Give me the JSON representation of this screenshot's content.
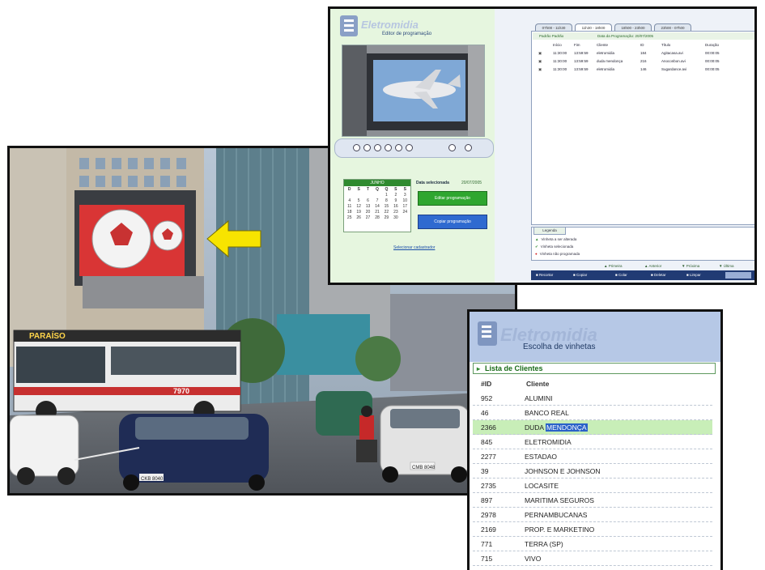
{
  "editor": {
    "brand": "Eletromidia",
    "subtitle": "Editor de programação",
    "data_label": "Data selecionada",
    "data_value": "20/07/2005",
    "editar_button": "Editar programação",
    "copiar_button": "Copiar programação",
    "selecionar_link": "Selecionar cadastrador",
    "calendar": {
      "month": "JUNHO",
      "weekdays": [
        "D",
        "S",
        "T",
        "Q",
        "Q",
        "S",
        "S"
      ],
      "days": [
        "",
        "",
        "",
        "",
        "1",
        "2",
        "3",
        "4",
        "5",
        "6",
        "7",
        "8",
        "9",
        "10",
        "11",
        "12",
        "13",
        "14",
        "15",
        "16",
        "17",
        "18",
        "19",
        "20",
        "21",
        "22",
        "23",
        "24",
        "25",
        "26",
        "27",
        "28",
        "29",
        "30",
        ""
      ]
    },
    "tabs": [
      "07h00 - 11h30",
      "11h30 - 18h00",
      "18h00 - 23h00",
      "23h00 - 07h00"
    ],
    "active_tab": 1,
    "status_left": "Padrão Padrão",
    "status_right": "Data da Programação: 20/07/2005",
    "columns": [
      "Início",
      "Fim",
      "Cliente",
      "ID",
      "Título",
      "Duração"
    ],
    "rows": [
      {
        "inicio": "11:30:00",
        "fim": "13:59:59",
        "cliente": "eletromidia",
        "id": "184",
        "titulo": "Agitacasa.avi",
        "duracao": "00:00:05"
      },
      {
        "inicio": "11:30:00",
        "fim": "13:59:59",
        "cliente": "duda mendonça",
        "id": "216",
        "titulo": "Anoconbon.avi",
        "duracao": "00:00:05"
      },
      {
        "inicio": "11:30:00",
        "fim": "13:59:59",
        "cliente": "eletromidia",
        "id": "146",
        "titulo": "Sugardance.avi",
        "duracao": "00:00:05"
      }
    ],
    "legend_tab": "Legenda",
    "legend": [
      "Vinheta a ser alterada",
      "Vinheta selecionada",
      "Vinheta não programada"
    ],
    "nav": [
      "Primeira",
      "Anterior",
      "Próxima",
      "Última"
    ],
    "actions": [
      "Recortar",
      "Copiar",
      "Colar",
      "Deletar",
      "Limpar"
    ]
  },
  "clients": {
    "brand": "Eletromidia",
    "title": "Escolha de vinhetas",
    "section": "Lista de Clientes",
    "col_id": "#ID",
    "col_cliente": "Cliente",
    "selected_index": 2,
    "highlight_word": "MENDONÇA",
    "rows": [
      {
        "id": "952",
        "nome": "ALUMINI"
      },
      {
        "id": "46",
        "nome": "BANCO REAL"
      },
      {
        "id": "2366",
        "nome": "DUDA ",
        "nome2": "MENDONÇA"
      },
      {
        "id": "845",
        "nome": "ELETROMIDIA"
      },
      {
        "id": "2277",
        "nome": "ESTADAO"
      },
      {
        "id": "39",
        "nome": "JOHNSON E JOHNSON"
      },
      {
        "id": "2735",
        "nome": "LOCASITE"
      },
      {
        "id": "897",
        "nome": "MARITIMA SEGUROS"
      },
      {
        "id": "2978",
        "nome": "PERNAMBUCANAS"
      },
      {
        "id": "2169",
        "nome": "PROP. E MARKETINO"
      },
      {
        "id": "771",
        "nome": "TERRA (SP)"
      },
      {
        "id": "715",
        "nome": "VIVO"
      }
    ]
  },
  "photo": {
    "bus_sign": "PARAÍSO",
    "bus_number": "7970",
    "plate_left": "CKB 8040",
    "plate_right": "CMB 8048"
  },
  "colors": {
    "accent_green": "#2f8a2f",
    "nav_blue": "#213b74",
    "arrow_yellow": "#f7e400"
  }
}
